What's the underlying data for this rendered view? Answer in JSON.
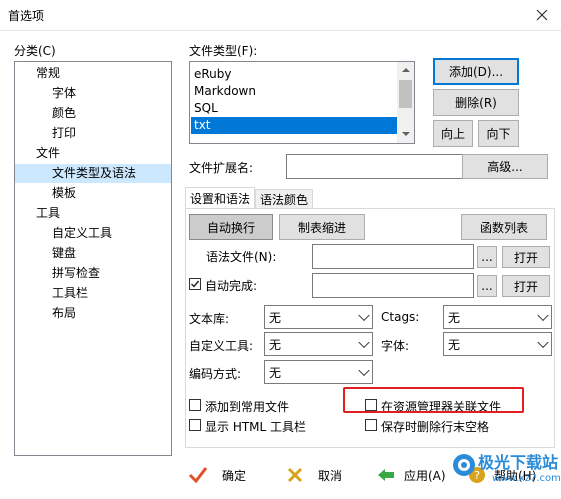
{
  "window": {
    "title": "首选项"
  },
  "categories": {
    "label": "分类(C)",
    "items": [
      {
        "label": "常规",
        "level": 0
      },
      {
        "label": "字体",
        "level": 1
      },
      {
        "label": "颜色",
        "level": 1
      },
      {
        "label": "打印",
        "level": 1
      },
      {
        "label": "文件",
        "level": 0
      },
      {
        "label": "文件类型及语法",
        "level": 1,
        "selected": true
      },
      {
        "label": "模板",
        "level": 1
      },
      {
        "label": "工具",
        "level": 0
      },
      {
        "label": "自定义工具",
        "level": 1
      },
      {
        "label": "键盘",
        "level": 1
      },
      {
        "label": "拼写检查",
        "level": 1
      },
      {
        "label": "工具栏",
        "level": 1
      },
      {
        "label": "布局",
        "level": 1
      }
    ]
  },
  "filetypes": {
    "label": "文件类型(F):",
    "items": [
      "eRuby",
      "Markdown",
      "SQL",
      "txt"
    ],
    "selected": "txt"
  },
  "buttons": {
    "add": "添加(D)...",
    "delete": "删除(R)",
    "up": "向上",
    "down": "向下",
    "advanced": "高级...",
    "auto_wrap": "自动换行",
    "tab_indent": "制表缩进",
    "func_list": "函数列表",
    "browse": "...",
    "open": "打开",
    "ok": "确定",
    "cancel": "取消",
    "apply": "应用(A)",
    "help": "帮助(H)"
  },
  "ext": {
    "label": "文件扩展名:",
    "value": ""
  },
  "tabs": [
    "设置和语法",
    "语法颜色"
  ],
  "syntax_file": {
    "label": "语法文件(N):",
    "value": ""
  },
  "auto_complete": {
    "label": "自动完成:",
    "checked": true,
    "value": ""
  },
  "combos": {
    "library": {
      "label": "文本库:",
      "value": "无"
    },
    "ctags": {
      "label": "Ctags:",
      "value": "无"
    },
    "custom_tool": {
      "label": "自定义工具:",
      "value": "无"
    },
    "font": {
      "label": "字体:",
      "value": "无"
    },
    "encoding": {
      "label": "编码方式:",
      "value": "无"
    }
  },
  "checks": {
    "add_common": {
      "label": "添加到常用文件",
      "checked": false
    },
    "assoc_explorer": {
      "label": "在资源管理器关联文件",
      "checked": false
    },
    "show_html": {
      "label": "显示 HTML 工具栏",
      "checked": false
    },
    "trim_trailing": {
      "label": "保存时删除行末空格",
      "checked": false
    }
  },
  "colors": {
    "accent": "#0078d7",
    "highlight_box": "#e02020"
  },
  "watermark": {
    "text": "极光下载站",
    "url": "www.xz7.com"
  }
}
